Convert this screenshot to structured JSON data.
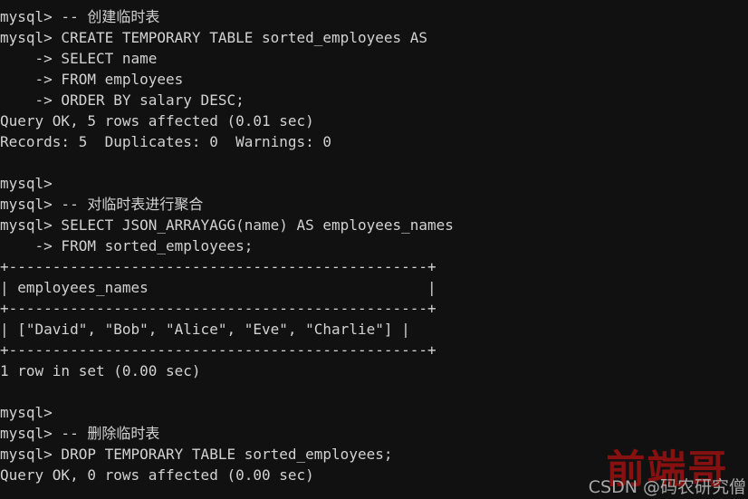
{
  "terminal": {
    "title": "mysql-client-session",
    "background_color": "#111111",
    "text_color": "#d2d2d2",
    "prompt": "mysql>",
    "continuation_prompt": "->",
    "lines": [
      "mysql> -- 创建临时表",
      "mysql> CREATE TEMPORARY TABLE sorted_employees AS",
      "    -> SELECT name",
      "    -> FROM employees",
      "    -> ORDER BY salary DESC;",
      "Query OK, 5 rows affected (0.01 sec)",
      "Records: 5  Duplicates: 0  Warnings: 0",
      "",
      "mysql>",
      "mysql> -- 对临时表进行聚合",
      "mysql> SELECT JSON_ARRAYAGG(name) AS employees_names",
      "    -> FROM sorted_employees;",
      "+------------------------------------------------+",
      "| employees_names                                |",
      "+------------------------------------------------+",
      "| [\"David\", \"Bob\", \"Alice\", \"Eve\", \"Charlie\"] |",
      "+------------------------------------------------+",
      "1 row in set (0.00 sec)",
      "",
      "mysql>",
      "mysql> -- 删除临时表",
      "mysql> DROP TEMPORARY TABLE sorted_employees;",
      "Query OK, 0 rows affected (0.00 sec)"
    ]
  },
  "result_table": {
    "columns": [
      "employees_names"
    ],
    "rows": [
      [
        "[\"David\", \"Bob\", \"Alice\", \"Eve\", \"Charlie\"]"
      ]
    ],
    "row_count_text": "1 row in set (0.00 sec)"
  },
  "statements": {
    "comment_create": "-- 创建临时表",
    "create_table": "CREATE TEMPORARY TABLE sorted_employees AS",
    "select_name": "SELECT name",
    "from_employees": "FROM employees",
    "order_by": "ORDER BY salary DESC;",
    "create_status": "Query OK, 5 rows affected (0.01 sec)",
    "create_records": "Records: 5  Duplicates: 0  Warnings: 0",
    "comment_aggregate": "-- 对临时表进行聚合",
    "select_aggregate": "SELECT JSON_ARRAYAGG(name) AS employees_names",
    "from_sorted": "FROM sorted_employees;",
    "comment_drop": "-- 删除临时表",
    "drop_table": "DROP TEMPORARY TABLE sorted_employees;",
    "drop_status": "Query OK, 0 rows affected (0.00 sec)"
  },
  "watermark": {
    "main": "前端哥",
    "sub": "CSDN @码农研究僧",
    "main_color": "#8e1111",
    "sub_color": "#b9b9b9"
  }
}
